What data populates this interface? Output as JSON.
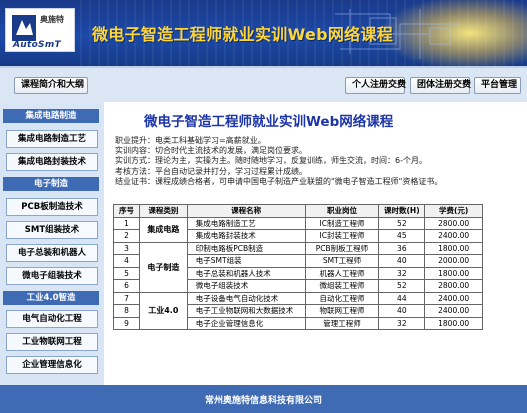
{
  "header": {
    "title": "微电子智造工程师就业实训Web网络课程",
    "logo_cn": "奥施特",
    "logo_en": "AutoSmT"
  },
  "nav": {
    "left_button": "课程简介和大纲",
    "buttons": [
      "个人注册交费",
      "团体注册交费",
      "平台管理"
    ]
  },
  "sidebar": {
    "sections": [
      {
        "label": "集成电路制造",
        "items": [
          "集成电路制造工艺",
          "集成电路封装技术"
        ]
      },
      {
        "label": "电子制造",
        "items": [
          "PCB板制造技术",
          "SMT组装技术",
          "电子总装和机器人",
          "微电子组装技术"
        ]
      },
      {
        "label": "工业4.0智造",
        "items": [
          "电气自动化工程",
          "工业物联网工程",
          "企业管理信息化"
        ]
      }
    ]
  },
  "main": {
    "title": "微电子智造工程师就业实训Web网络课程",
    "info": [
      "职业提升：电类工科基础学习=高薪就业。",
      "实训内容：切合时代主流技术的发展，满足岗位要求。",
      "实训方式：理论为主，实操为主。随时随地学习，反复训练，师生交流，时间：6-个月。",
      "考核方法：平台自动记录并打分，学习过程累计成绩。",
      "结业证书：课程成绩合格者，可申请中国电子制造产业联盟的\"微电子智造工程师\"资格证书。"
    ],
    "table": {
      "headers": [
        "序号",
        "课程类别",
        "课程名称",
        "职业岗位",
        "课时数(H)",
        "学费(元)"
      ],
      "categories": [
        "集成电路",
        "电子制造",
        "工业4.0"
      ],
      "rows": [
        {
          "no": "1",
          "name": "集成电路制造工艺",
          "job": "IC制造工程师",
          "hours": "52",
          "fee": "2800.00"
        },
        {
          "no": "2",
          "name": "集成电路封装技术",
          "job": "IC封装工程师",
          "hours": "45",
          "fee": "2400.00"
        },
        {
          "no": "3",
          "name": "印制电路板PCB制造",
          "job": "PCB制板工程师",
          "hours": "36",
          "fee": "1800.00"
        },
        {
          "no": "4",
          "name": "电子SMT组装",
          "job": "SMT工程师",
          "hours": "40",
          "fee": "2000.00"
        },
        {
          "no": "5",
          "name": "电子总装和机器人技术",
          "job": "机器人工程师",
          "hours": "32",
          "fee": "1800.00"
        },
        {
          "no": "6",
          "name": "微电子组装技术",
          "job": "微组装工程师",
          "hours": "52",
          "fee": "2800.00"
        },
        {
          "no": "7",
          "name": "电子设备电气自动化技术",
          "job": "自动化工程师",
          "hours": "44",
          "fee": "2400.00"
        },
        {
          "no": "8",
          "name": "电子工业物联网和大数据技术",
          "job": "物联网工程师",
          "hours": "40",
          "fee": "2400.00"
        },
        {
          "no": "9",
          "name": "电子企业管理信息化",
          "job": "管理工程师",
          "hours": "32",
          "fee": "1800.00"
        }
      ]
    }
  },
  "footer": {
    "text": "常州奥施特信息科技有限公司"
  },
  "colors": {
    "banner": "#1c49a8",
    "title_yellow": "#ffd63a",
    "section_blue": "#3f6ab4",
    "main_title": "#1d35a8"
  }
}
